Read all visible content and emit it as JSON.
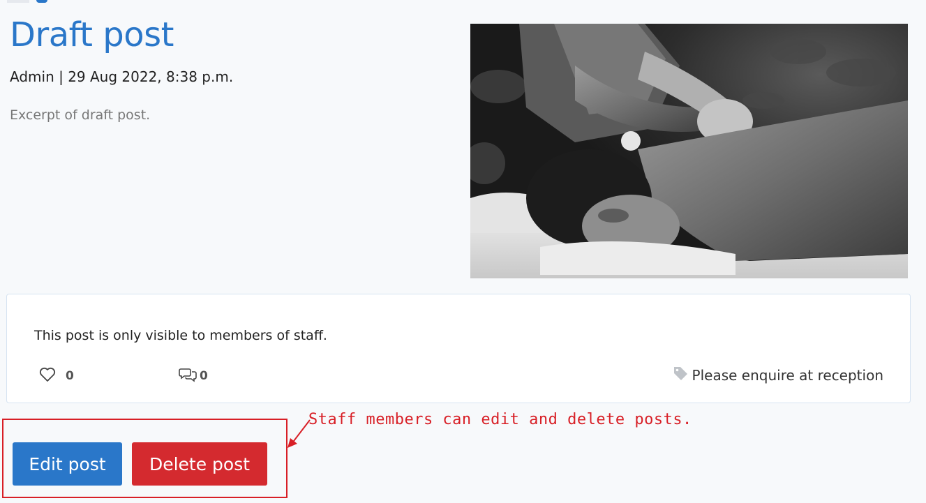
{
  "post": {
    "title": "Draft post",
    "meta": "Admin | 29 Aug 2022, 8:38 p.m.",
    "excerpt": "Excerpt of draft post.",
    "notice": "This post is only visible to members of staff.",
    "likes_count": "0",
    "comments_count": "0",
    "tag_text": "Please enquire at reception"
  },
  "image": {
    "description_icon": "massage-photo"
  },
  "actions": {
    "edit_label": "Edit post",
    "delete_label": "Delete post"
  },
  "annotation": {
    "text": "Staff members can edit and delete posts."
  },
  "colors": {
    "primary": "#2a77c9",
    "danger": "#d42a2f",
    "annotation": "#d81f26"
  },
  "icons": {
    "like": "heart-icon",
    "comment": "comments-icon",
    "tag": "tag-icon"
  }
}
